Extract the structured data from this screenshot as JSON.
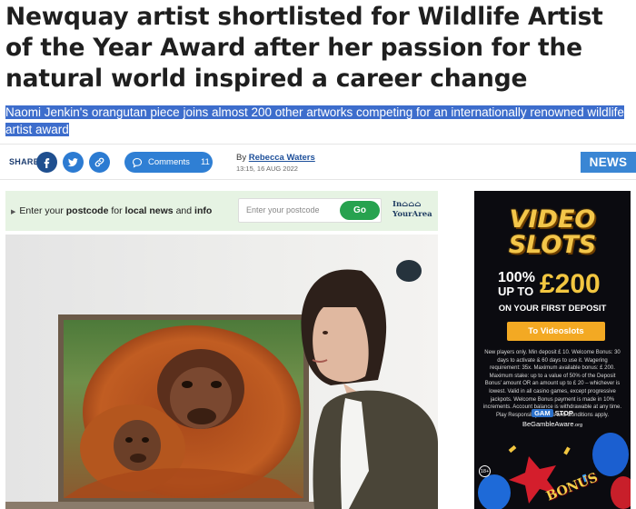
{
  "article": {
    "headline": "Newquay artist shortlisted for Wildlife Artist of the Year Award after her passion for the natural world inspired a career change",
    "standfirst": "Naomi Jenkin's orangutan piece joins almost 200 other artworks competing for an internationally renowned wildlife artist award"
  },
  "meta": {
    "share_label": "SHARE",
    "comments_label": "Comments",
    "comments_count": "11",
    "byline_prefix": "By",
    "author": "Rebecca Waters",
    "date": "13:15, 16 AUG 2022",
    "section_tag": "NEWS"
  },
  "postcode": {
    "text_prefix": "Enter your",
    "text_postcode": "postcode",
    "text_for": "for",
    "text_local": "local news",
    "text_and": "and",
    "text_info": "info",
    "placeholder": "Enter your postcode",
    "go_label": "Go",
    "brand_line1": "In⌂⌂⌂",
    "brand_line2": "YourArea"
  },
  "ad": {
    "logo_line1": "VIDEO",
    "logo_line2": "SLOTS",
    "pct": "100%",
    "upto": "UP TO",
    "amount": "£200",
    "first_deposit": "ON YOUR FIRST DEPOSIT",
    "cta": "To Videoslots",
    "terms": "New players only. Min deposit £ 10. Welcome Bonus: 30 days to activate & 60 days to use it. Wagering requirement: 35x. Maximum available bonus: £ 200. Maximum stake: up to a value of 50% of the Deposit Bonus' amount OR an amount up to £ 20 – whichever is lowest. Valid in all casino games, except progressive jackpots. Welcome Bonus payment is made in 10% increments. Account balance is withdrawable at any time. Play Responsibly. Terms and Conditions apply.",
    "gamstop_badge": "GAM",
    "gamstop_text": "STOP",
    "bga": "BeGambleAware",
    "bga_suffix": ".org",
    "age": "18+",
    "bonus": "BONUS"
  },
  "colors": {
    "accent_blue": "#2f7fd4",
    "navy": "#1d3d70",
    "highlight": "#3d6dcc",
    "go_green": "#27a24f",
    "ad_gold": "#f2c640"
  }
}
